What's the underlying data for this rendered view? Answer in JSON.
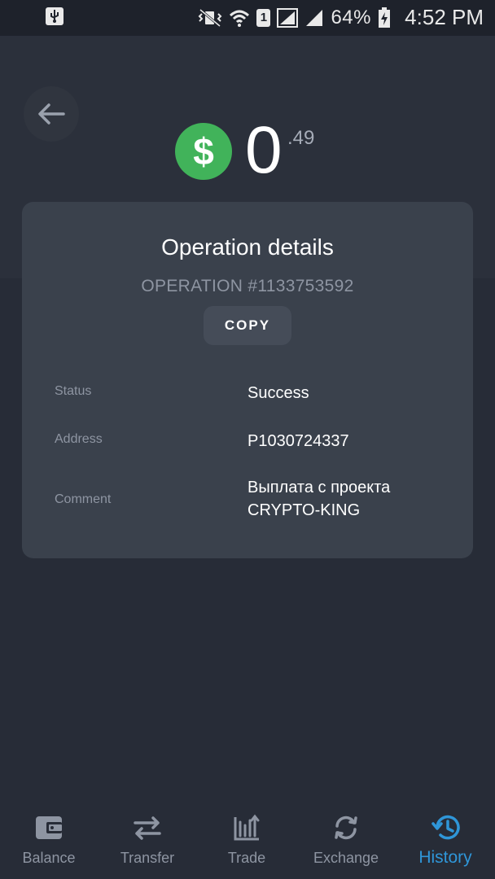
{
  "status_bar": {
    "sim_slot": "1",
    "battery_percent": "64%",
    "time": "4:52 PM"
  },
  "balance": {
    "currency_icon": "dollar-icon",
    "integer": "0",
    "fraction": ".49",
    "accent": "#41b35a"
  },
  "operation": {
    "title": "Operation details",
    "id_label": "OPERATION #1133753592",
    "copy_label": "COPY",
    "rows": [
      {
        "label": "Status",
        "value": "Success"
      },
      {
        "label": "Address",
        "value": "P1030724337"
      },
      {
        "label": "Comment",
        "value": "Выплата с проекта CRYPTO-KING"
      }
    ]
  },
  "nav": {
    "active_color": "#2f96d8",
    "items": [
      {
        "label": "Balance",
        "icon": "wallet-icon"
      },
      {
        "label": "Transfer",
        "icon": "transfer-arrows-icon"
      },
      {
        "label": "Trade",
        "icon": "trade-chart-icon"
      },
      {
        "label": "Exchange",
        "icon": "exchange-cycle-icon"
      },
      {
        "label": "History",
        "icon": "history-clock-icon"
      }
    ]
  }
}
